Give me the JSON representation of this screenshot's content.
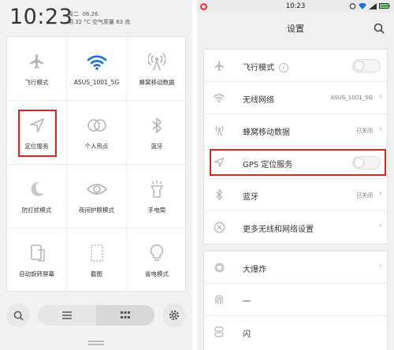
{
  "left_screen": {
    "clock": "10:23",
    "weekday": "周二",
    "date": "06.26",
    "weather": "阴 32 °C 空气质量 63 良",
    "tiles": [
      {
        "label": "飞行模式",
        "icon": "airplane-icon"
      },
      {
        "label": "ASUS_1001_5G",
        "icon": "wifi-icon"
      },
      {
        "label": "蜂窝移动数据",
        "icon": "cellular-icon"
      },
      {
        "label": "定位服务",
        "icon": "location-icon"
      },
      {
        "label": "个人热点",
        "icon": "hotspot-icon"
      },
      {
        "label": "蓝牙",
        "icon": "bluetooth-icon"
      },
      {
        "label": "防打扰模式",
        "icon": "moon-icon"
      },
      {
        "label": "夜间护眼模式",
        "icon": "eye-icon"
      },
      {
        "label": "手电筒",
        "icon": "flashlight-icon"
      },
      {
        "label": "自动旋转屏幕",
        "icon": "rotate-icon"
      },
      {
        "label": "截图",
        "icon": "screenshot-icon"
      },
      {
        "label": "省电模式",
        "icon": "bulb-icon"
      }
    ],
    "highlighted_tile": "定位服务",
    "colors": {
      "wifi_active": "#1e6fd9",
      "highlight": "#d9261c"
    }
  },
  "right_screen": {
    "status_time": "10:23",
    "title": "设置",
    "rows_group1": [
      {
        "label": "飞行模式",
        "control": "toggle",
        "icon": "airplane-icon",
        "has_info": true
      },
      {
        "label": "无线网络",
        "value": "ASUS_1001_5G",
        "icon": "wifi-icon"
      },
      {
        "label": "蜂窝移动数据",
        "value": "已关闭",
        "icon": "cellular-icon"
      },
      {
        "label": "GPS 定位服务",
        "control": "toggle",
        "icon": "location-icon"
      },
      {
        "label": "蓝牙",
        "value": "已关闭",
        "icon": "bluetooth-icon"
      },
      {
        "label": "更多无线和网络设置",
        "icon": "more-icon"
      }
    ],
    "rows_group2": [
      {
        "label": "大爆炸",
        "icon": "bigbang-icon"
      },
      {
        "label": "一",
        "icon": "fingerprint-icon"
      },
      {
        "label": "闪",
        "icon": "toggle-icon"
      }
    ],
    "highlighted_row": "GPS 定位服务",
    "info_glyph": "i"
  }
}
